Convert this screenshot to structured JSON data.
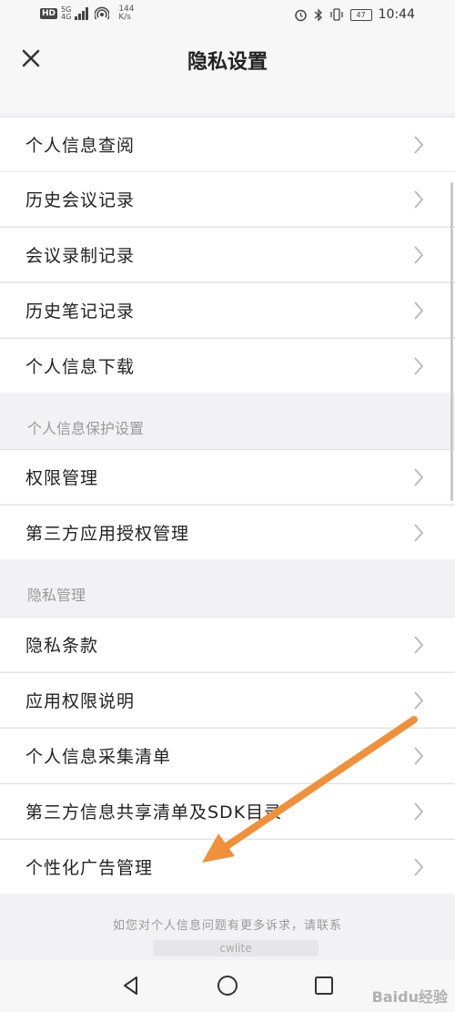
{
  "status_bar": {
    "hd": "HD",
    "network": "5G",
    "net_sub": "4G",
    "speed_value": "144",
    "speed_unit": "K/s",
    "battery": "47",
    "time": "10:44"
  },
  "header": {
    "title": "隐私设置"
  },
  "groups": [
    {
      "header": "",
      "items": [
        {
          "label": "个人信息查阅"
        },
        {
          "label": "历史会议记录"
        },
        {
          "label": "会议录制记录"
        },
        {
          "label": "历史笔记记录"
        },
        {
          "label": "个人信息下载"
        }
      ]
    },
    {
      "header": "个人信息保护设置",
      "items": [
        {
          "label": "权限管理"
        },
        {
          "label": "第三方应用授权管理"
        }
      ]
    },
    {
      "header": "隐私管理",
      "items": [
        {
          "label": "隐私条款"
        },
        {
          "label": "应用权限说明"
        },
        {
          "label": "个人信息采集清单"
        },
        {
          "label": "第三方信息共享清单及SDK目录"
        },
        {
          "label": "个性化广告管理"
        }
      ]
    }
  ],
  "footer": {
    "note": "如您对个人信息问题有更多诉求，请联系",
    "contact": "cwlite"
  },
  "watermark": "Baidu经验",
  "annotation": {
    "arrow_color": "#f0903a"
  }
}
